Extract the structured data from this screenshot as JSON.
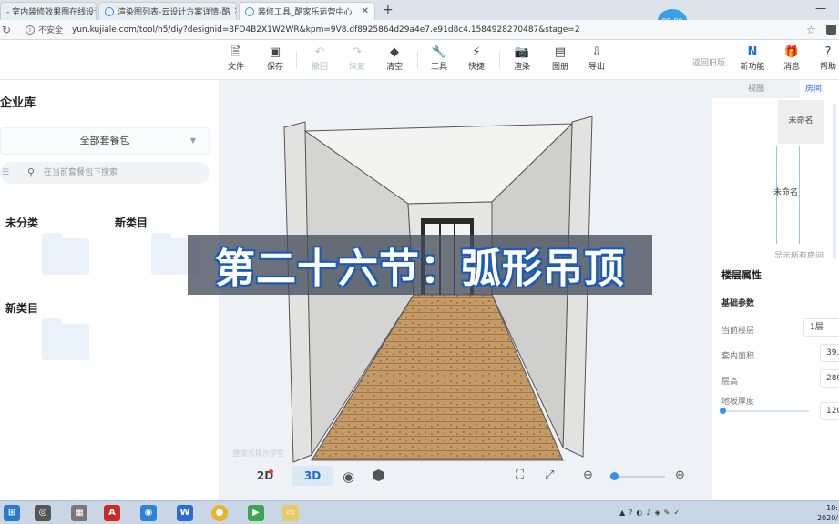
{
  "browser": {
    "tabs": [
      {
        "title": "- 室内装修效果图在线设计",
        "active": false
      },
      {
        "title": "渲染图列表-云设计方案详情-酷",
        "active": false
      },
      {
        "title": "装修工具_酷家乐运营中心",
        "active": true
      }
    ],
    "new_tab": "+",
    "record_badge": "00:00",
    "security": "不安全",
    "url": "yun.kujiale.com/tool/h5/diy?designid=3FO4B2X1W2WR&kpm=9V8.df8925864d29a4e7.e91d8c4.1584928270487&stage=2"
  },
  "toolbar": {
    "items": [
      {
        "label": "文件",
        "icon": "file-icon"
      },
      {
        "label": "保存",
        "icon": "save-icon"
      },
      {
        "label": "撤回",
        "icon": "undo-icon",
        "disabled": true
      },
      {
        "label": "恢复",
        "icon": "redo-icon",
        "disabled": true
      },
      {
        "label": "清空",
        "icon": "eraser-icon"
      },
      {
        "label": "工具",
        "icon": "wrench-icon"
      },
      {
        "label": "快捷",
        "icon": "lightning-icon"
      },
      {
        "label": "渲染",
        "icon": "camera-icon"
      },
      {
        "label": "图册",
        "icon": "album-icon"
      },
      {
        "label": "导出",
        "icon": "export-icon"
      }
    ],
    "return_old": "返回旧版",
    "right_items": [
      {
        "label": "新功能",
        "icon": "new-feature-icon"
      },
      {
        "label": "消息",
        "icon": "gift-icon"
      },
      {
        "label": "帮助",
        "icon": "help-icon"
      }
    ]
  },
  "library": {
    "title": "企业库",
    "package_select": "全部套餐包",
    "search_placeholder": "在当前套餐包下搜索",
    "cards": [
      "未分类",
      "新类目",
      "新类目"
    ]
  },
  "canvas": {
    "banner": "第二十六节：弧形吊顶",
    "watermark": "酷家乐提示学堂",
    "view_2d": "2D",
    "view_3d": "3D"
  },
  "right_panel": {
    "tabs": [
      "视图",
      "房间"
    ],
    "rooms": [
      "未命名",
      "未命名"
    ],
    "show_all": "显示所有房间",
    "props_title": "楼层属性",
    "props_sub": "基础参数",
    "fields": [
      {
        "label": "当前楼层",
        "value": "1层"
      },
      {
        "label": "套内面积",
        "value": "39."
      },
      {
        "label": "层高",
        "value": "280"
      },
      {
        "label": "地板厚度",
        "value": "120"
      }
    ]
  },
  "taskbar": {
    "clock_time": "10:",
    "clock_date": "2020/"
  }
}
